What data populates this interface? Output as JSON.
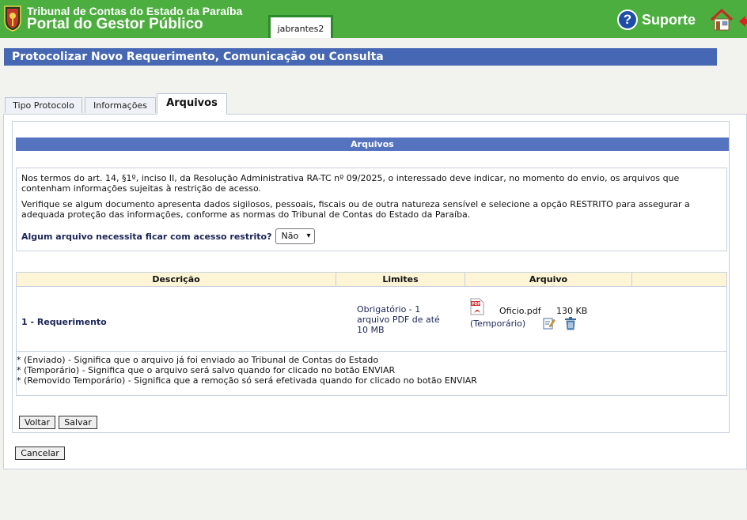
{
  "header": {
    "org_name": "Tribunal de Contas do Estado da Paraíba",
    "portal_name": "Portal do Gestor Público",
    "username": "jabrantes2",
    "support_label": "Suporte",
    "support_icon_glyph": "?",
    "icons": {
      "crest": "crest-logo",
      "support": "help-circle-icon",
      "home": "home-icon",
      "exit": "exit-icon"
    },
    "colors": {
      "bar": "#4cae3e",
      "badge_border": "#2d8a2a"
    }
  },
  "page_title": "Protocolizar Novo Requerimento, Comunicação ou Consulta",
  "tabs": [
    {
      "label": "Tipo Protocolo",
      "active": false
    },
    {
      "label": "Informações",
      "active": false
    },
    {
      "label": "Arquivos",
      "active": true
    }
  ],
  "section": {
    "title": "Arquivos",
    "notice_p1": "Nos termos do art. 14, §1º, inciso II, da Resolução Administrativa RA-TC nº 09/2025, o interessado deve indicar, no momento do envio, os arquivos que contenham informações sujeitas à restrição de acesso.",
    "notice_p2": "Verifique se algum documento apresenta dados sigilosos, pessoais, fiscais ou de outra natureza sensível e selecione a opção RESTRITO para assegurar a adequada proteção das informações, conforme as normas do Tribunal de Contas do Estado da Paraíba.",
    "restrict_question": "Algum arquivo necessita ficar com acesso restrito?",
    "restrict_value": "Não"
  },
  "files_table": {
    "columns": [
      "Descrição",
      "Limites",
      "Arquivo"
    ],
    "rows": [
      {
        "description": "1 - Requerimento",
        "limits": "Obrigatório - 1 arquivo PDF de até 10 MB",
        "file_name": "Oficio.pdf",
        "file_size": "130 KB",
        "file_status": "(Temporário)",
        "icons": [
          "pdf-icon",
          "edit-icon",
          "trash-icon"
        ]
      }
    ],
    "legend": [
      "* (Enviado) - Significa que o arquivo já foi enviado ao Tribunal de Contas do Estado",
      "* (Temporário) - Significa que o arquivo será salvo quando for clicado no botão ENVIAR",
      "* (Removido Temporário) - Significa que a remoção só será efetivada quando for clicado no botão ENVIAR"
    ]
  },
  "buttons": {
    "back": "Voltar",
    "save": "Salvar",
    "cancel": "Cancelar"
  },
  "colors": {
    "title_bar": "#4667b3",
    "section_bar": "#5673c0",
    "table_header": "#fdf5d6"
  }
}
